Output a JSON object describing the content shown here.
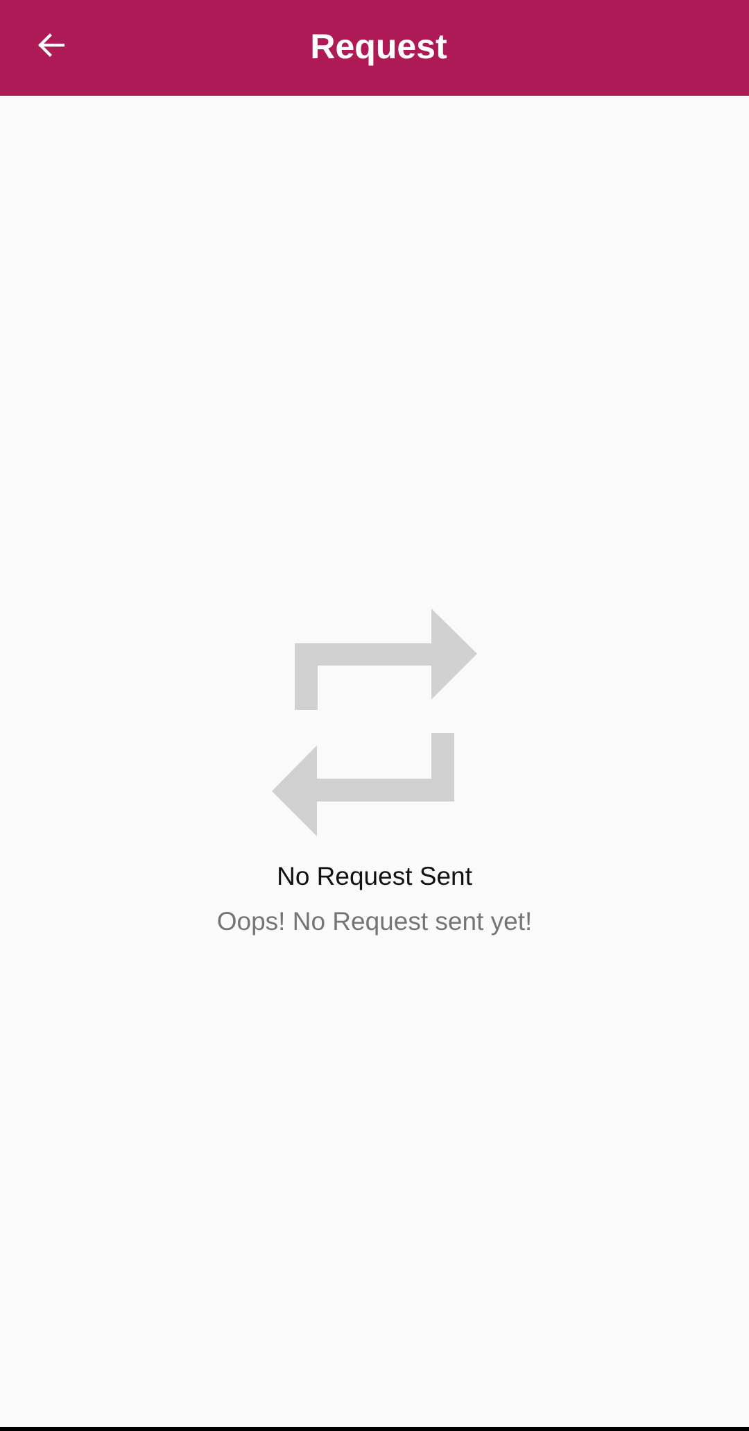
{
  "app_bar": {
    "title": "Request",
    "back_icon": "arrow-back-icon",
    "color": "#ad1a55"
  },
  "empty_state": {
    "icon": "repeat-icon",
    "icon_color": "#d0d0d0",
    "title": "No Request Sent",
    "subtitle": "Oops! No Request sent yet!"
  }
}
